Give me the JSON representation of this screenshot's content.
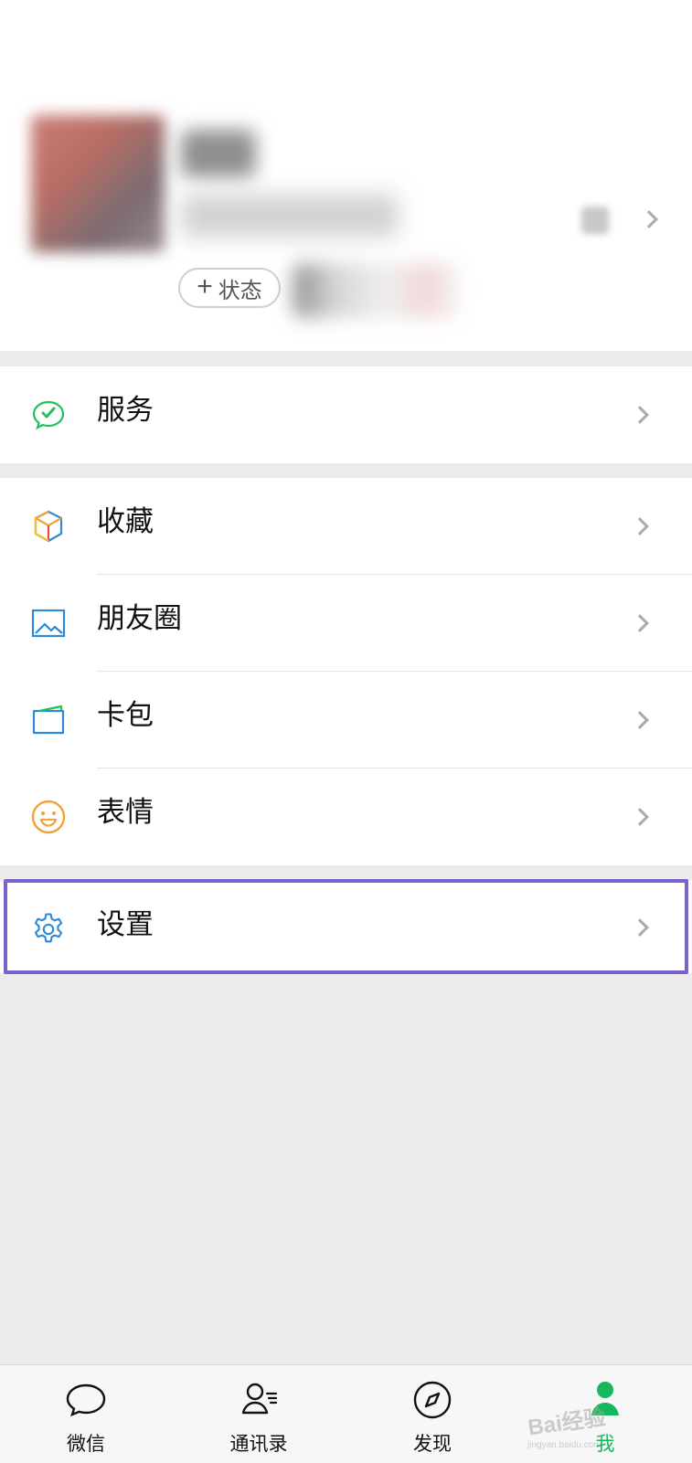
{
  "profile": {
    "status_label": "状态",
    "status_plus": "+"
  },
  "menu": {
    "service": "服务",
    "favorites": "收藏",
    "moments": "朋友圈",
    "card_pack": "卡包",
    "stickers": "表情",
    "settings": "设置"
  },
  "tabs": {
    "wechat": "微信",
    "contacts": "通讯录",
    "discover": "发现",
    "me": "我"
  },
  "watermark": {
    "main": "Bai经验",
    "sub": "jingyan.baidu.com"
  },
  "icons": {
    "service": "wechat-pay-icon",
    "favorites": "cube-icon",
    "moments": "image-icon",
    "card_pack": "card-icon",
    "stickers": "smile-icon",
    "settings": "gear-icon",
    "tab_wechat": "chat-bubble-icon",
    "tab_contacts": "contacts-icon",
    "tab_discover": "compass-icon",
    "tab_me": "user-icon"
  },
  "colors": {
    "accent_green": "#16b85b",
    "service_green": "#20c05c",
    "blue": "#2d8ad8",
    "orange": "#f2a23a",
    "selected_outline": "#7b61cf"
  }
}
